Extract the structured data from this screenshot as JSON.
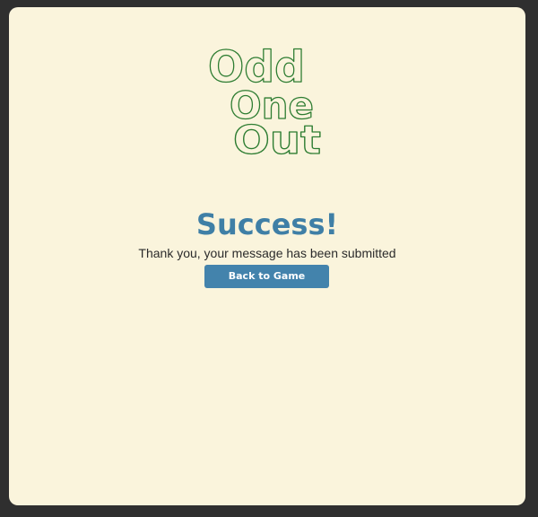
{
  "logo": {
    "line1": "Odd",
    "line2": "One",
    "line3": "Out",
    "color": "#2e7d32"
  },
  "title": "Success!",
  "message": "Thank you, your message has been submitted",
  "button": {
    "label": "Back to Game",
    "color": "#4383ac"
  },
  "colors": {
    "background": "#faf4dc",
    "title": "#3f7fa6",
    "frame": "#2f2f2f"
  }
}
